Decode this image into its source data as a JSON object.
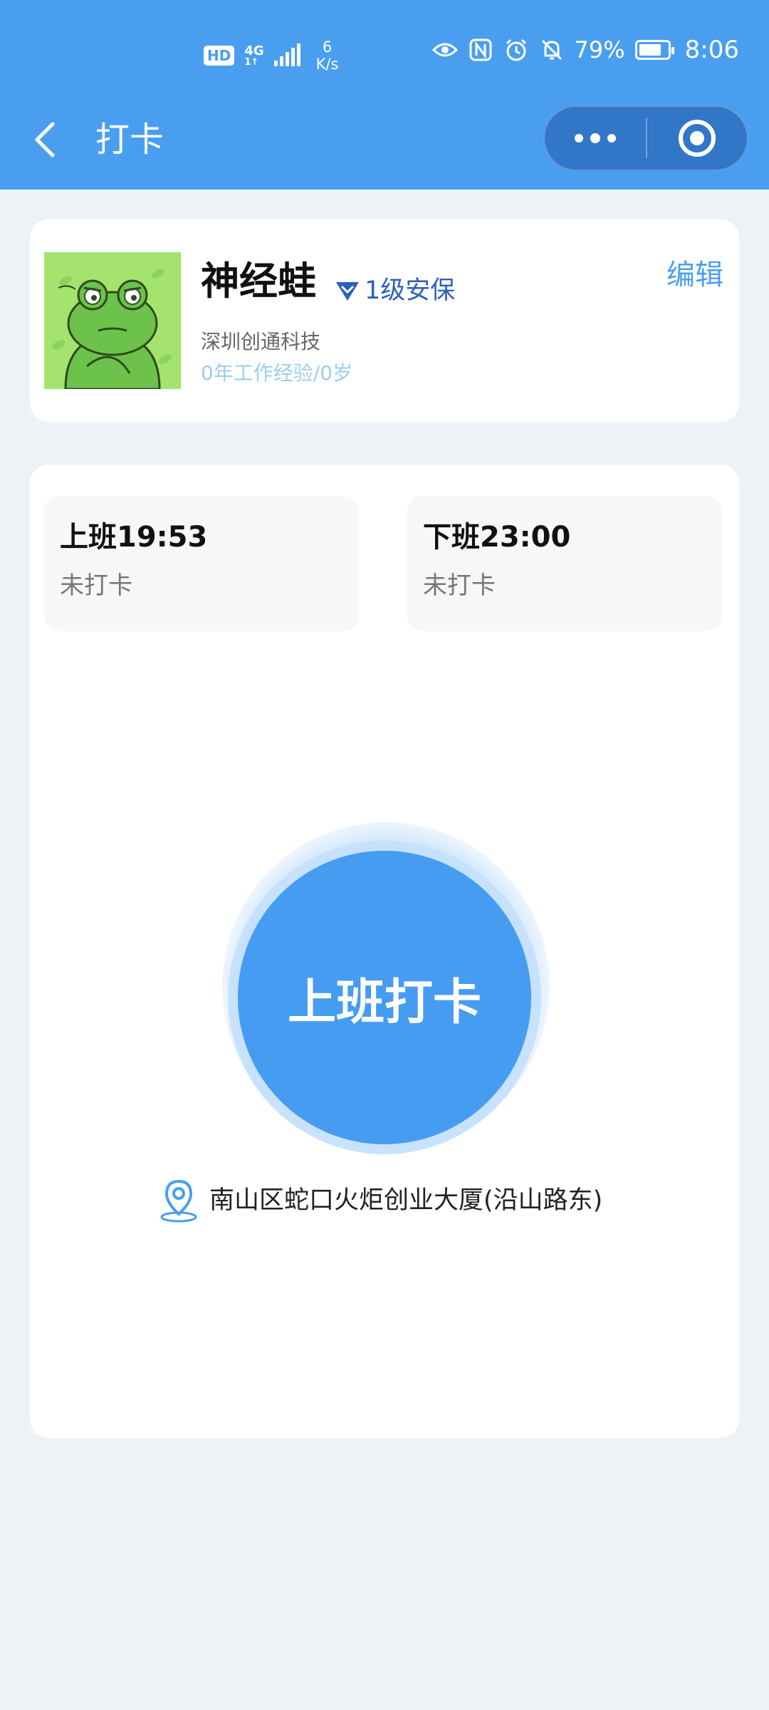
{
  "status_bar": {
    "hd": "HD",
    "network": "4G",
    "network_sub": "1↑",
    "speed_value": "6",
    "speed_unit": "K/s",
    "battery_percent": "79%",
    "time": "8:06"
  },
  "navbar": {
    "title": "打卡"
  },
  "profile": {
    "name": "神经蛙",
    "level": "1级安保",
    "edit_label": "编辑",
    "company": "深圳创通科技",
    "experience": "0年工作经验/0岁"
  },
  "shifts": [
    {
      "time_label": "上班19:53",
      "status": "未打卡"
    },
    {
      "time_label": "下班23:00",
      "status": "未打卡"
    }
  ],
  "punch": {
    "button_label": "上班打卡"
  },
  "location": {
    "address": "南山区蛇口火炬创业大厦(沿山路东)"
  },
  "colors": {
    "primary": "#4a9ef0",
    "capsule": "#3276c8",
    "background": "#eef2f6",
    "level_badge": "#2f5fb8"
  }
}
